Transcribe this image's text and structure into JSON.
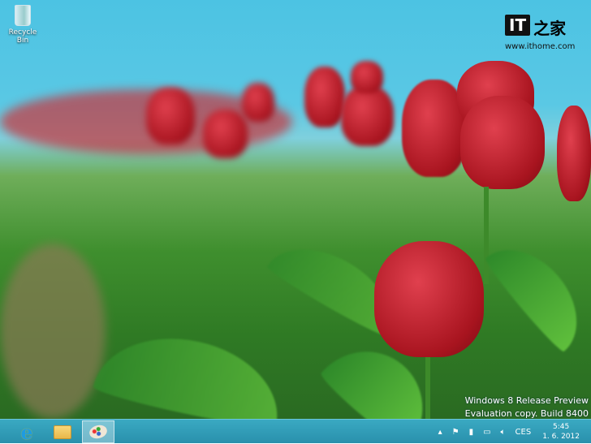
{
  "desktop": {
    "icons": [
      {
        "label": "Recycle Bin",
        "icon": "recycle-bin-icon"
      }
    ]
  },
  "logo": {
    "mark": "IT",
    "chinese": "之家",
    "url": "www.ithome.com"
  },
  "watermark": {
    "line1": "Windows 8 Release Preview",
    "line2": "Evaluation copy. Build 8400"
  },
  "taskbar": {
    "apps": [
      {
        "name": "Internet Explorer",
        "icon": "internet-explorer-icon"
      },
      {
        "name": "File Explorer",
        "icon": "folder-icon"
      },
      {
        "name": "Paint",
        "icon": "paint-palette-icon",
        "active": true
      }
    ]
  },
  "tray": {
    "language": "CES",
    "time": "5:45",
    "date": "1. 6. 2012"
  }
}
